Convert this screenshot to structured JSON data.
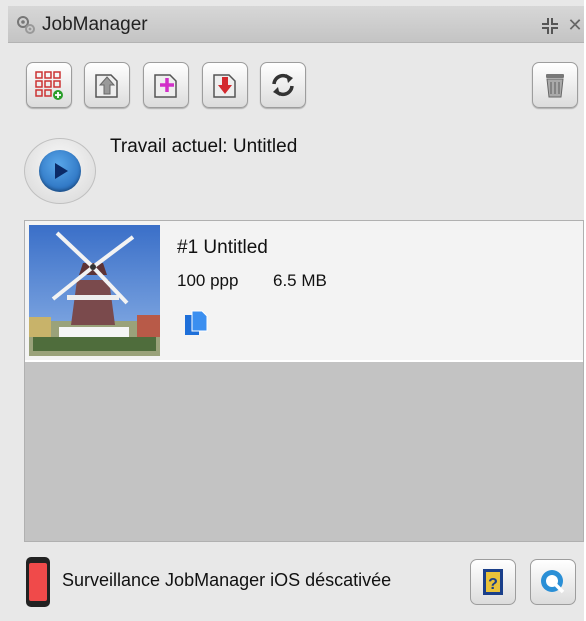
{
  "window": {
    "title": "JobManager"
  },
  "colors": {
    "accent": "#1b5fb2",
    "phone_status": "#f04a4a",
    "toolbar_magenta": "#d22fc8",
    "toolbar_red": "#d3282d"
  },
  "toolbar": {
    "icons": [
      "grid-add-icon",
      "upload-icon",
      "add-job-icon",
      "download-icon",
      "refresh-icon",
      "trash-icon"
    ]
  },
  "current": {
    "label": "Travail actuel: Untitled"
  },
  "jobs": [
    {
      "title": "#1 Untitled",
      "resolution": "100 ppp",
      "size": "6.5 MB",
      "icon": "document-icon"
    }
  ],
  "status": {
    "text": "Surveillance JobManager iOS déscativée"
  }
}
